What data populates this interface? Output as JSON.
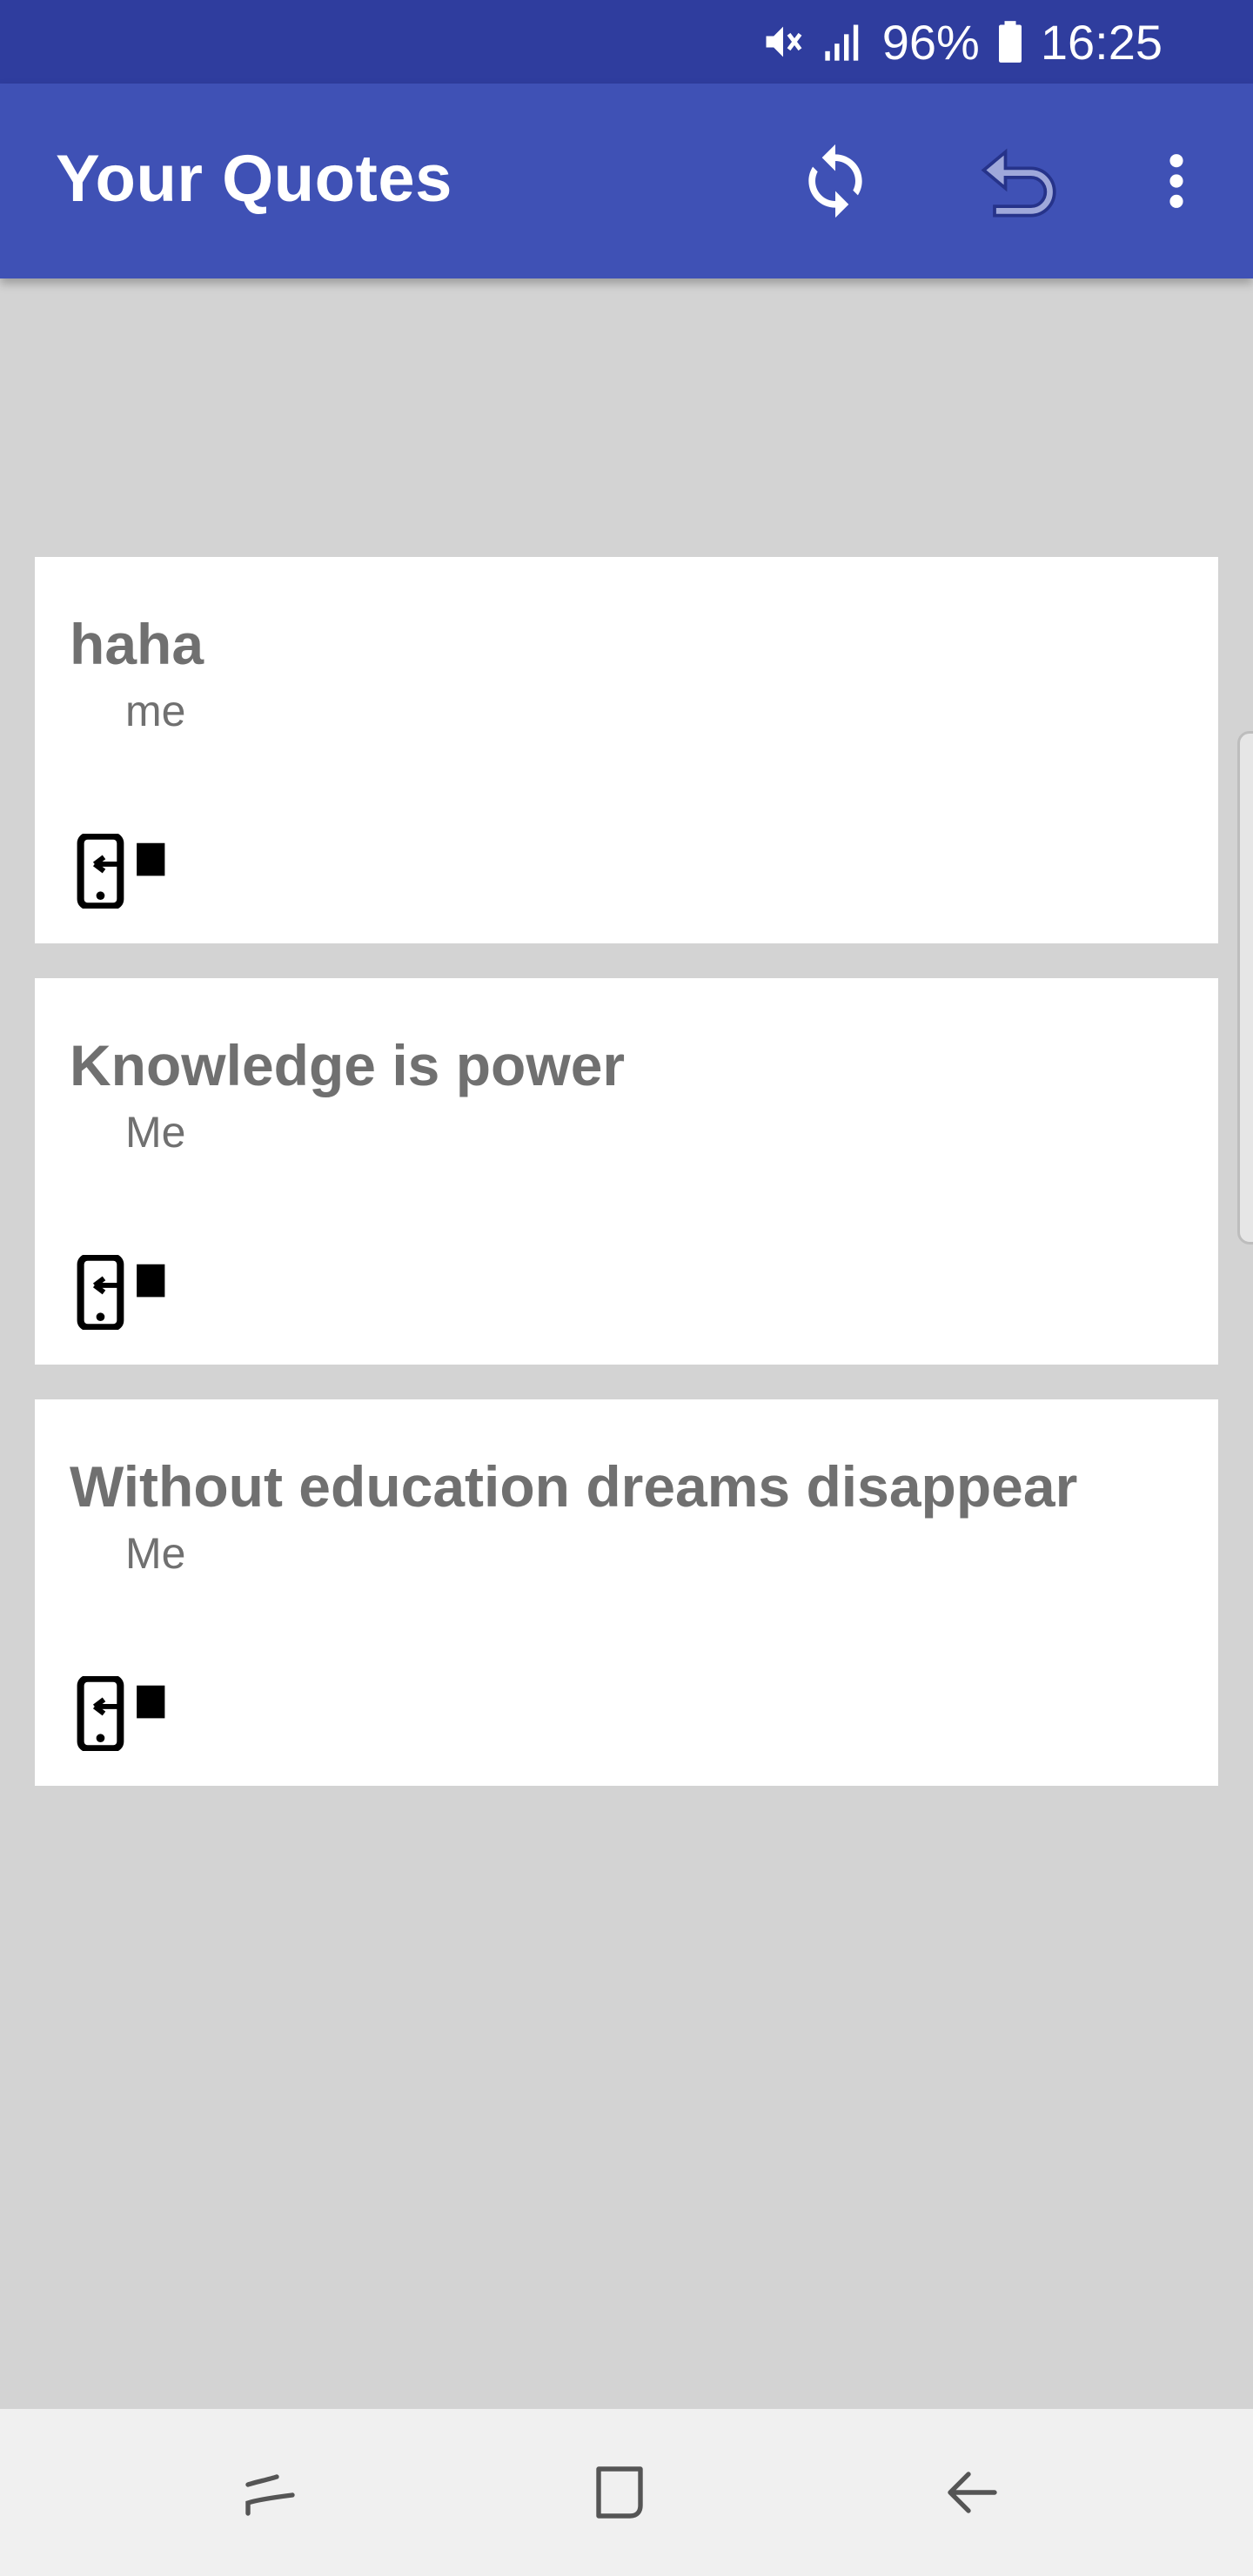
{
  "status_bar": {
    "battery_percent": "96%",
    "time": "16:25",
    "icons": [
      "mute-icon",
      "signal-icon",
      "battery-icon"
    ]
  },
  "app_bar": {
    "title": "Your Quotes",
    "actions": [
      "refresh-icon",
      "undo-icon",
      "overflow-menu-icon"
    ],
    "background": "#3f51b5",
    "status_background": "#2f3d9e"
  },
  "quotes": [
    {
      "text": "haha",
      "author": "me"
    },
    {
      "text": "Knowledge is power",
      "author": "Me"
    },
    {
      "text": "Without education dreams disappear",
      "author": "Me"
    }
  ],
  "nav_bar": {
    "buttons": [
      "recents-icon",
      "home-icon",
      "back-icon"
    ]
  }
}
